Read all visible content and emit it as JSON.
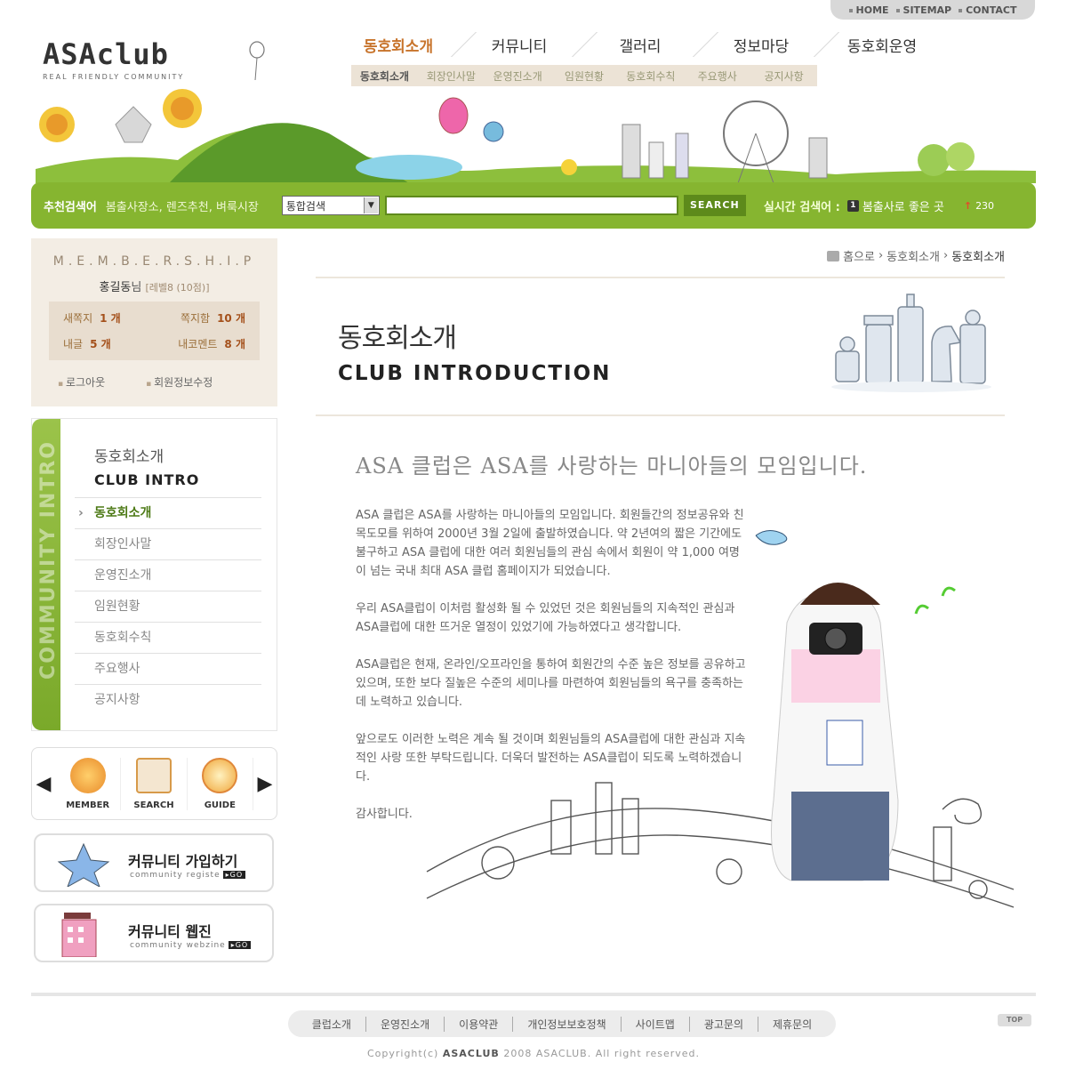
{
  "util": {
    "home": "HOME",
    "sitemap": "SITEMAP",
    "contact": "CONTACT"
  },
  "logo": {
    "name": "ASAclub",
    "tagline": "REAL FRIENDLY COMMUNITY"
  },
  "gnb": [
    "동호회소개",
    "커뮤니티",
    "갤러리",
    "정보마당",
    "동호회운영"
  ],
  "subnav": [
    "동호회소개",
    "회장인사말",
    "운영진소개",
    "임원현황",
    "동호회수칙",
    "주요행사",
    "공지사항"
  ],
  "search": {
    "rec_label": "추천검색어",
    "rec_keywords": "봄출사장소, 렌즈추천, 벼룩시장",
    "select_value": "통합검색",
    "button": "SEARCH",
    "realtime_label": "실시간 검색어 :",
    "realtime_rank": "1",
    "realtime_keyword": "봄출사로 좋은 곳",
    "realtime_count": "230"
  },
  "member": {
    "title": "M.E.M.B.E.R.S.H.I.P",
    "user_name": "홍길동",
    "user_suffix": "님",
    "level": "[레벨8 (10점)]",
    "stats": [
      {
        "label": "새쪽지",
        "value": "1 개"
      },
      {
        "label": "쪽지함",
        "value": "10 개"
      },
      {
        "label": "내글",
        "value": "5 개"
      },
      {
        "label": "내코멘트",
        "value": "8 개"
      }
    ],
    "logout": "로그아웃",
    "edit": "회원정보수정"
  },
  "lmenu": {
    "vertical": "COMMUNITY INTRO",
    "title_ko": "동호회소개",
    "title_en": "CLUB INTRO",
    "items": [
      "동호회소개",
      "회장인사말",
      "운영진소개",
      "임원현황",
      "동호회수칙",
      "주요행사",
      "공지사항"
    ]
  },
  "quick": {
    "member": "MEMBER",
    "search": "SEARCH",
    "guide": "GUIDE"
  },
  "banners": [
    {
      "title": "커뮤니티 가입하기",
      "sub": "community registe",
      "go": "▸GO"
    },
    {
      "title": "커뮤니티 웹진",
      "sub": "community webzine",
      "go": "▸GO"
    }
  ],
  "breadcrumb": {
    "home": "홈으로",
    "b1": "동호회소개",
    "b2": "동호회소개"
  },
  "page": {
    "title_ko": "동호회소개",
    "title_en": "CLUB INTRODUCTION",
    "slogan": "ASA 클럽은 ASA를 사랑하는 마니아들의 모임입니다.",
    "paragraphs": [
      "ASA 클럽은 ASA를 사랑하는 마니아들의 모임입니다. 회원들간의 정보공유와 친목도모를 위하여 2000년 3월 2일에 출발하였습니다. 약 2년여의 짧은 기간에도 불구하고 ASA 클럽에 대한 여러 회원님들의 관심 속에서 회원이 약 1,000 여명이 넘는 국내 최대 ASA 클럽 홈페이지가 되었습니다.",
      "우리 ASA클럽이 이처럼 활성화 될 수 있었던 것은 회원님들의 지속적인 관심과 ASA클럽에 대한 뜨거운 열정이 있었기에 가능하였다고 생각합니다.",
      "ASA클럽은 현재, 온라인/오프라인을 통하여 회원간의 수준 높은 정보를 공유하고 있으며, 또한 보다 질높은 수준의 세미나를 마련하여 회원님들의 욕구를 충족하는데 노력하고 있습니다.",
      "앞으로도 이러한 노력은 계속 될 것이며 회원님들의 ASA클럽에 대한 관심과 지속적인 사랑 또한 부탁드립니다. 더욱더 발전하는 ASA클럽이 되도록 노력하겠습니다.",
      "감사합니다."
    ]
  },
  "footer": {
    "links": [
      "클럽소개",
      "운영진소개",
      "이용약관",
      "개인정보보호정책",
      "사이트맵",
      "광고문의",
      "제휴문의"
    ],
    "top": "TOP",
    "copy_pre": "Copyright(c)",
    "copy_brand": "ASACLUB",
    "copy_post": "2008 ASACLUB. All right reserved."
  },
  "colors": {
    "green": "#86b530",
    "accent": "#c8742c",
    "beige": "#f3ede4"
  }
}
